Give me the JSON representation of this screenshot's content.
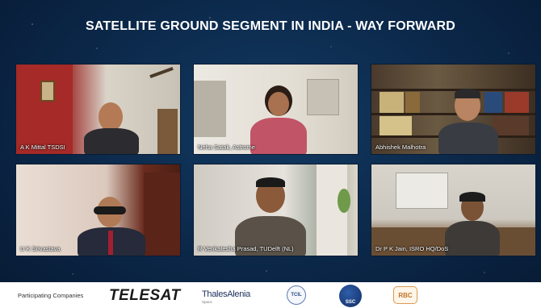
{
  "title": "SATELLITE GROUND SEGMENT IN INDIA - WAY FORWARD",
  "participants": [
    {
      "name": "A K Mittal TSDSI"
    },
    {
      "name": "Neha Satak, Astrome"
    },
    {
      "name": "Abhishek Malhotra"
    },
    {
      "name": "U K Srivastava"
    },
    {
      "name": "R Venkatesha Prasad, TUDelft (NL)"
    },
    {
      "name": "Dr P K Jain, ISRO HQ/DoS"
    }
  ],
  "footer": {
    "label": "Participating Companies",
    "logos": {
      "telesat": "TELESAT",
      "thales": "ThalesAlenia",
      "thales_sub": "Space",
      "tcil": "TCIL",
      "ssc": "SSC",
      "rbc": "RBC"
    }
  },
  "colors": {
    "background": "#0b2748",
    "footer": "#ffffff",
    "title_text": "#ffffff"
  }
}
